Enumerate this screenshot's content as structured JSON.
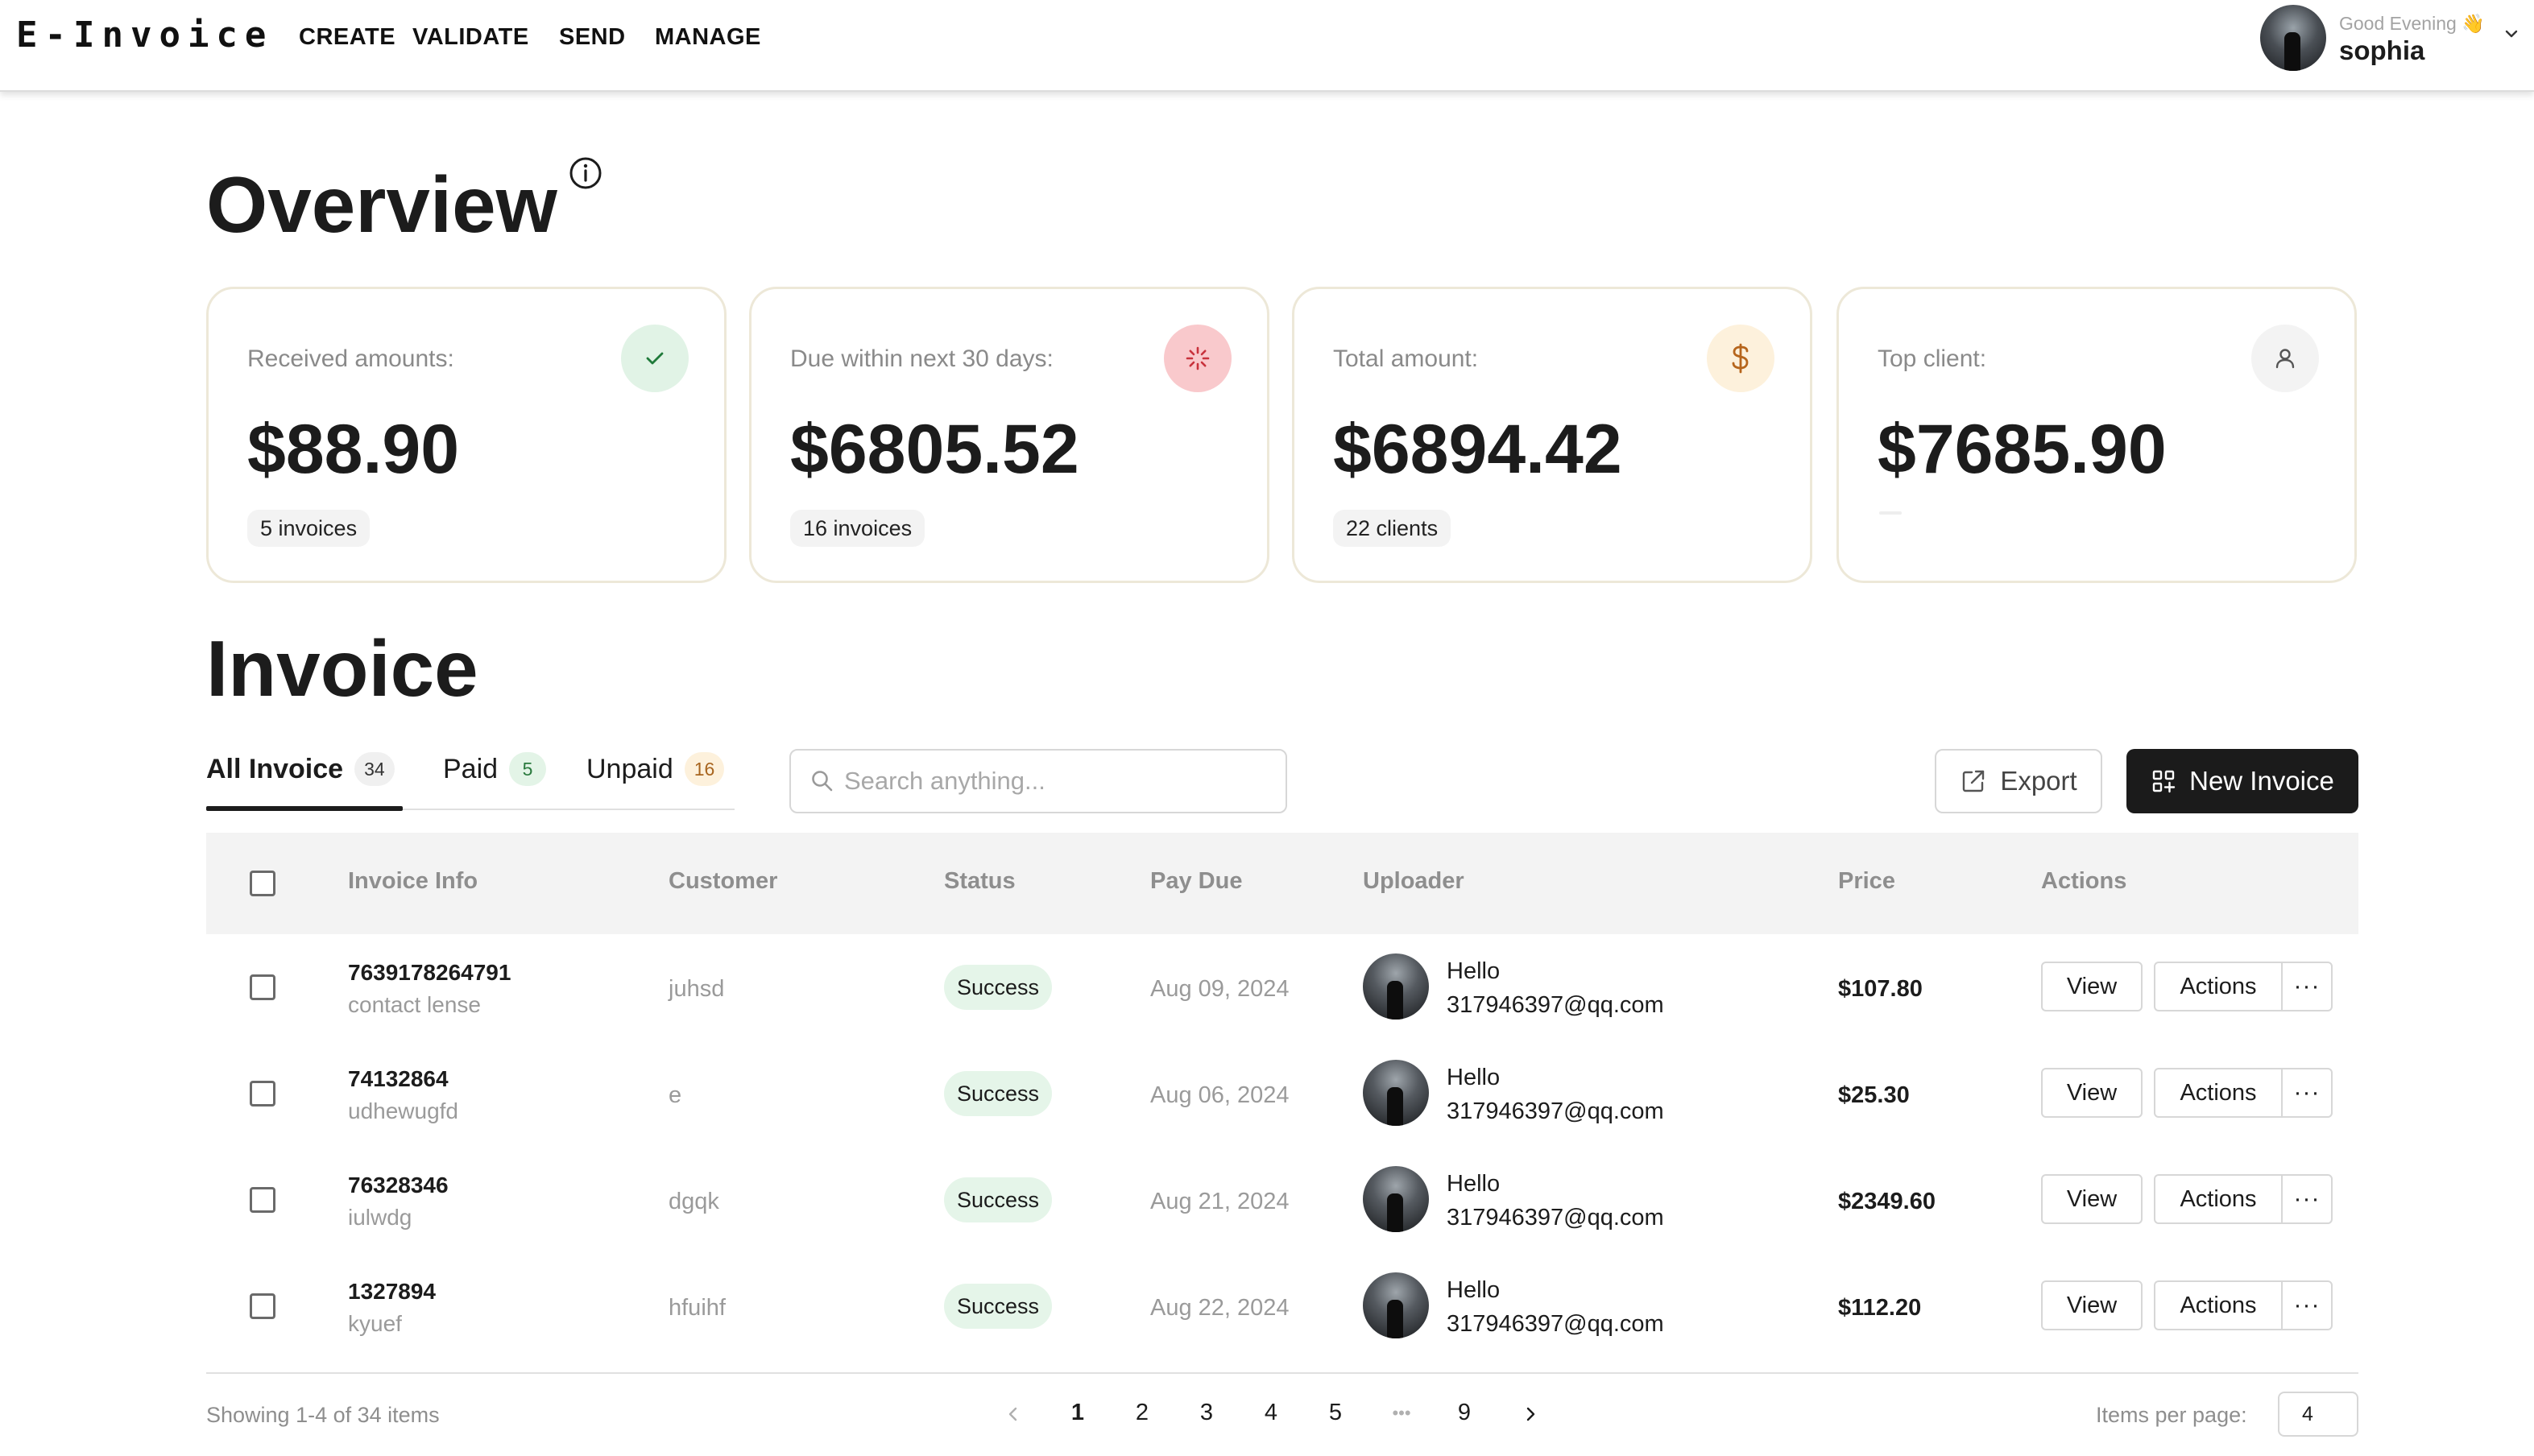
{
  "app": {
    "logo": "E-Invoice"
  },
  "nav": {
    "items": [
      "CREATE",
      "VALIDATE",
      "SEND",
      "MANAGE"
    ]
  },
  "user": {
    "greeting": "Good Evening 👋",
    "name": "sophia"
  },
  "overview": {
    "title": "Overview",
    "cards": [
      {
        "label": "Received amounts:",
        "value": "$88.90",
        "badge": "5 invoices",
        "icon": "check-icon",
        "icon_bg": "#e1f3e6",
        "icon_color": "#1f7a3a"
      },
      {
        "label": "Due within next 30 days:",
        "value": "$6805.52",
        "badge": "16 invoices",
        "icon": "loader-icon",
        "icon_bg": "#f9c9cc",
        "icon_color": "#c8323c"
      },
      {
        "label": "Total amount:",
        "value": "$6894.42",
        "badge": "22 clients",
        "icon": "dollar-icon",
        "icon_bg": "#fdf1dc",
        "icon_color": "#b6651c"
      },
      {
        "label": "Top client:",
        "value": "$7685.90",
        "badge": "",
        "icon": "user-icon",
        "icon_bg": "#f3f3f3",
        "icon_color": "#555555"
      }
    ]
  },
  "invoice": {
    "title": "Invoice",
    "tabs": [
      {
        "label": "All Invoice",
        "count": "34",
        "count_bg": "#f0f0f0",
        "count_color": "#333333"
      },
      {
        "label": "Paid",
        "count": "5",
        "count_bg": "#e3f4e7",
        "count_color": "#2a7a3e"
      },
      {
        "label": "Unpaid",
        "count": "16",
        "count_bg": "#fdf1dc",
        "count_color": "#a8651f"
      }
    ],
    "search_placeholder": "Search anything...",
    "export_label": "Export",
    "new_invoice_label": "New Invoice"
  },
  "table": {
    "headers": [
      "Invoice Info",
      "Customer",
      "Status",
      "Pay Due",
      "Uploader",
      "Price",
      "Actions"
    ],
    "rows": [
      {
        "id": "7639178264791",
        "desc": "contact lense",
        "customer": "juhsd",
        "status": "Success",
        "pay_due": "Aug 09, 2024",
        "uploader_name": "Hello",
        "uploader_email": "317946397@qq.com",
        "price": "$107.80",
        "view": "View",
        "actions": "Actions",
        "more": "···"
      },
      {
        "id": "74132864",
        "desc": "udhewugfd",
        "customer": "e",
        "status": "Success",
        "pay_due": "Aug 06, 2024",
        "uploader_name": "Hello",
        "uploader_email": "317946397@qq.com",
        "price": "$25.30",
        "view": "View",
        "actions": "Actions",
        "more": "···"
      },
      {
        "id": "76328346",
        "desc": "iulwdg",
        "customer": "dgqk",
        "status": "Success",
        "pay_due": "Aug 21, 2024",
        "uploader_name": "Hello",
        "uploader_email": "317946397@qq.com",
        "price": "$2349.60",
        "view": "View",
        "actions": "Actions",
        "more": "···"
      },
      {
        "id": "1327894",
        "desc": "kyuef",
        "customer": "hfuihf",
        "status": "Success",
        "pay_due": "Aug 22, 2024",
        "uploader_name": "Hello",
        "uploader_email": "317946397@qq.com",
        "price": "$112.20",
        "view": "View",
        "actions": "Actions",
        "more": "···"
      }
    ]
  },
  "pagination": {
    "showing": "Showing 1-4 of 34 items",
    "pages": [
      "1",
      "2",
      "3",
      "4",
      "5",
      "•••",
      "9"
    ],
    "current": "1",
    "items_per_page_label": "Items per page:",
    "items_per_page": "4"
  }
}
